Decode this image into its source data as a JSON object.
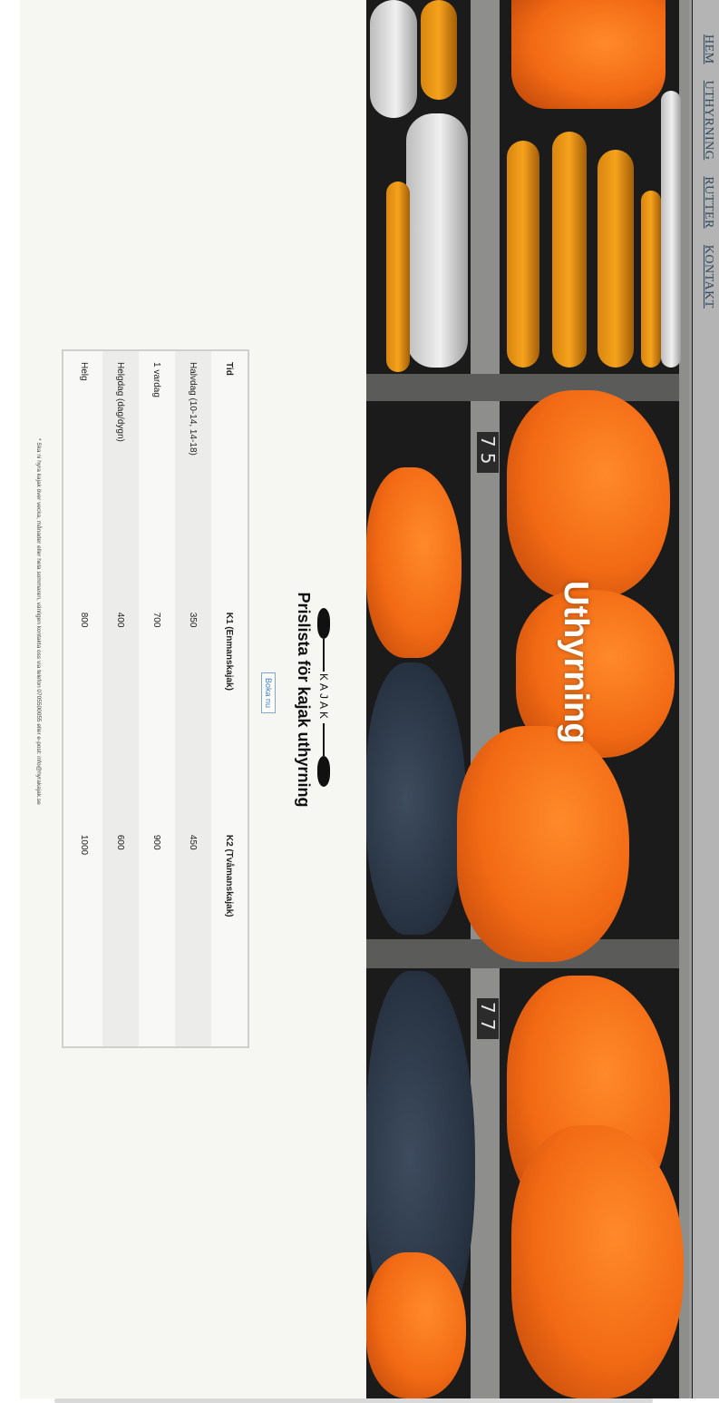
{
  "nav": {
    "items": [
      "HEM",
      "UTHYRNING",
      "RUTTER",
      "KONTAKT"
    ]
  },
  "hero": {
    "title": "Uthyrning",
    "rack_numbers": [
      "75",
      "77"
    ]
  },
  "section": {
    "logo_text": "KAJAK",
    "title": "Prislista för kajak uthyrning",
    "book_button": "Boka nu"
  },
  "price_table": {
    "headers": [
      "Tid",
      "K1 (Enmanskajak)",
      "K2 (Tvåmanskajak)"
    ],
    "rows": [
      [
        "Halvdag (10-14, 14-18)",
        "350",
        "450"
      ],
      [
        "1 vardag",
        "700",
        "900"
      ],
      [
        "Helgdag (dag/dygn)",
        "400",
        "600"
      ],
      [
        "Helg",
        "800",
        "1000"
      ]
    ]
  },
  "footnote": "* Ska ni hyra kajak över vecka, månader eller hela sommaren, vänligen kontakta oss via telefon 0705500055 eller e-post: info@hyrakajak.se",
  "colors": {
    "background": "#f6f7f3",
    "nav_bg": "#b4b4b4",
    "nav_link": "#2f4a5c",
    "kayak_orange": "#f26a14",
    "table_alt_row": "#ececea"
  }
}
